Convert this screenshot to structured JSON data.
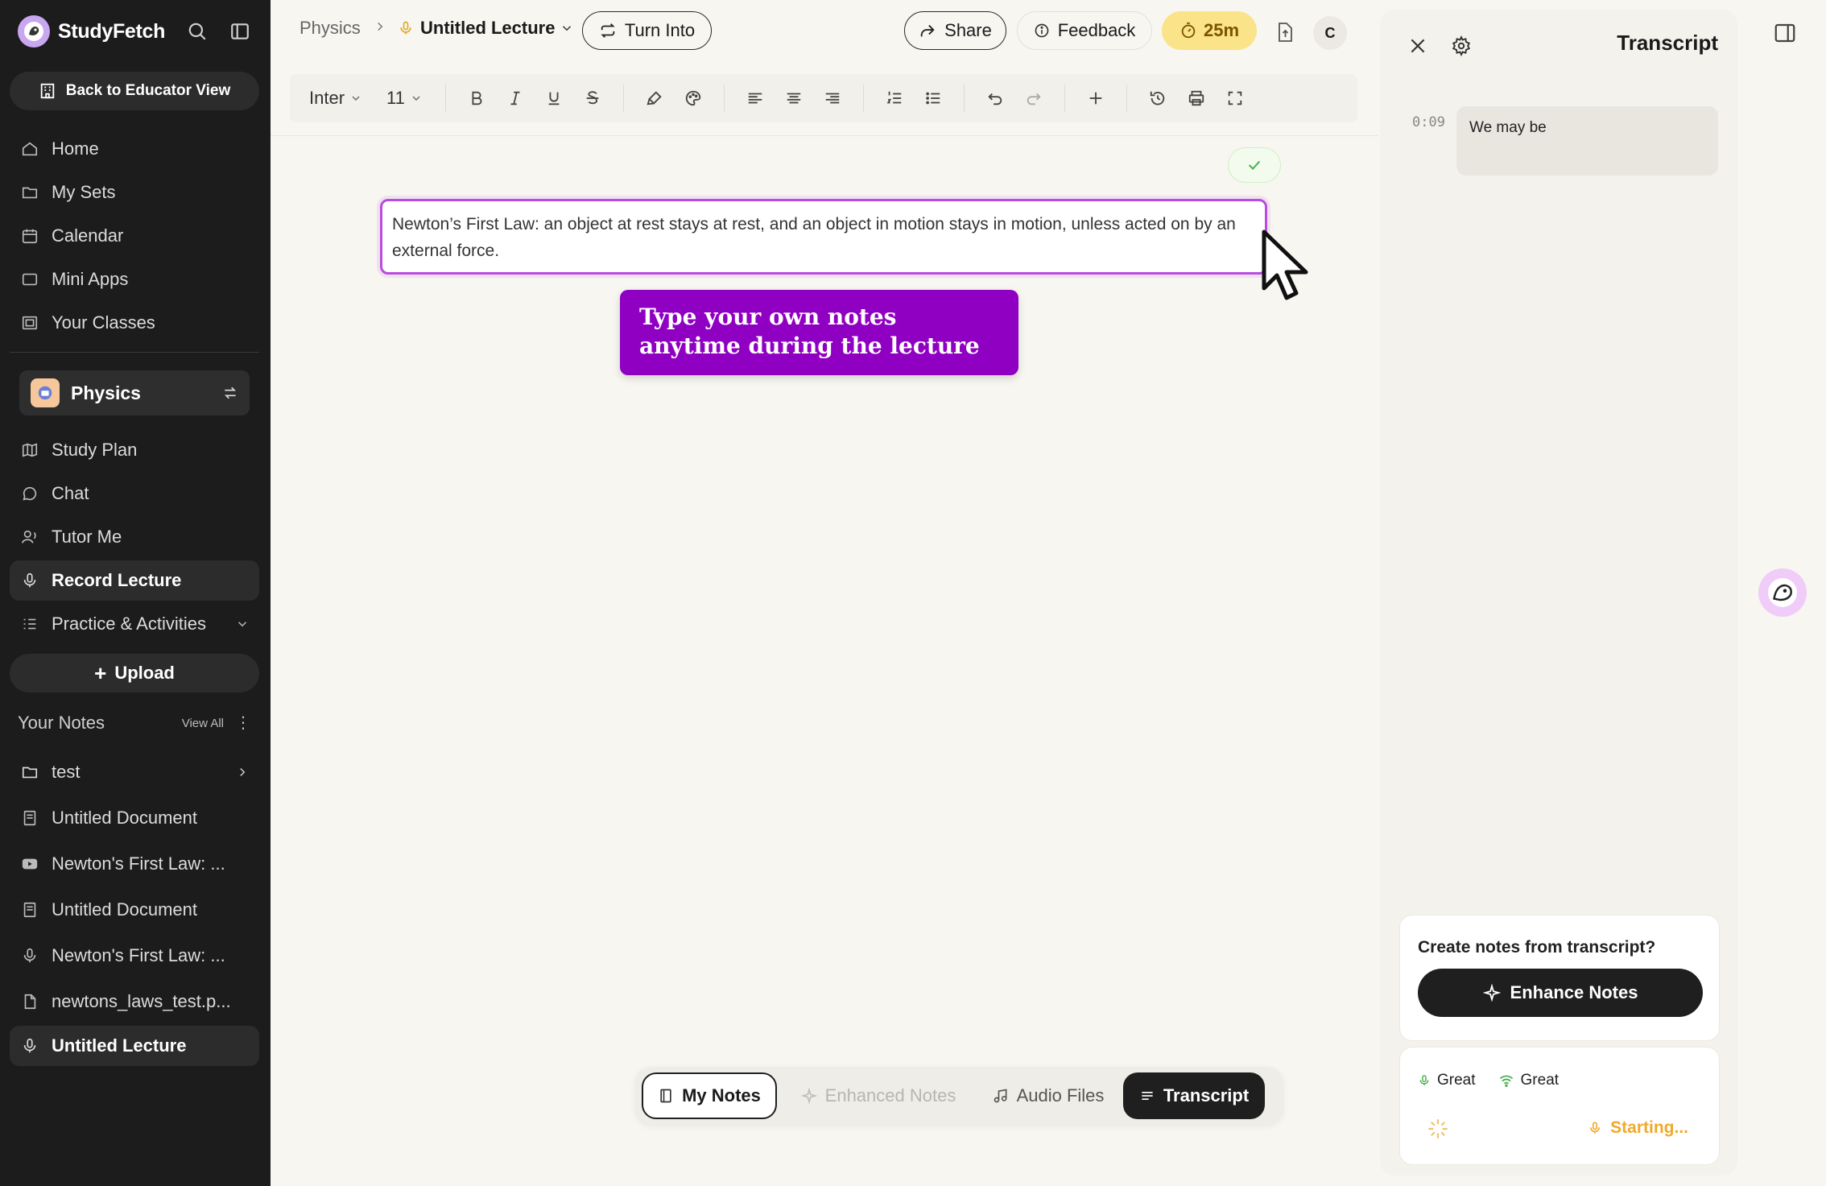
{
  "sidebar": {
    "brand": "StudyFetch",
    "educator_button": "Back to Educator View",
    "nav": [
      {
        "label": "Home",
        "icon": "home-icon"
      },
      {
        "label": "My Sets",
        "icon": "folder-icon"
      },
      {
        "label": "Calendar",
        "icon": "calendar-icon"
      },
      {
        "label": "Mini Apps",
        "icon": "app-icon"
      },
      {
        "label": "Your Classes",
        "icon": "classes-icon"
      }
    ],
    "class_name": "Physics",
    "class_nav": [
      {
        "label": "Study Plan",
        "icon": "map-icon"
      },
      {
        "label": "Chat",
        "icon": "chat-icon"
      },
      {
        "label": "Tutor Me",
        "icon": "tutor-icon"
      },
      {
        "label": "Record Lecture",
        "icon": "mic-icon"
      },
      {
        "label": "Practice & Activities",
        "icon": "list-icon"
      }
    ],
    "upload_label": "Upload",
    "notes_title": "Your Notes",
    "view_all": "View All",
    "notes": [
      {
        "label": "test",
        "icon": "folder-icon"
      },
      {
        "label": "Untitled Document",
        "icon": "document-icon"
      },
      {
        "label": "Newton's First Law: ...",
        "icon": "youtube-icon"
      },
      {
        "label": "Untitled Document",
        "icon": "document-icon"
      },
      {
        "label": "Newton's First Law: ...",
        "icon": "mic-icon"
      },
      {
        "label": "newtons_laws_test.p...",
        "icon": "pdf-icon"
      },
      {
        "label": "Untitled Lecture",
        "icon": "mic-icon"
      }
    ]
  },
  "header": {
    "breadcrumb_class": "Physics",
    "lecture_title": "Untitled Lecture",
    "turn_into": "Turn Into",
    "share": "Share",
    "feedback": "Feedback",
    "timer": "25m",
    "avatar_initial": "C"
  },
  "toolbar": {
    "font": "Inter",
    "size": "11"
  },
  "editor": {
    "note_text": "Newton’s First Law: an object at rest stays at rest, and an object in motion stays in motion, unless acted on by an external force.",
    "callout": "Type your own notes anytime during the lecture"
  },
  "bottom_tabs": {
    "my_notes": "My Notes",
    "enhanced_notes": "Enhanced Notes",
    "audio_files": "Audio Files",
    "transcript": "Transcript"
  },
  "transcript": {
    "title": "Transcript",
    "entries": [
      {
        "time": "0:09",
        "text": "We may be"
      }
    ],
    "enhance_question": "Create notes from transcript?",
    "enhance_button": "Enhance Notes",
    "mic_status": "Great",
    "network_status": "Great",
    "recording_status": "Starting..."
  },
  "colors": {
    "accent_purple": "#8f00c2",
    "timer_yellow": "#fbe38a",
    "starting_orange": "#f0a92a"
  }
}
